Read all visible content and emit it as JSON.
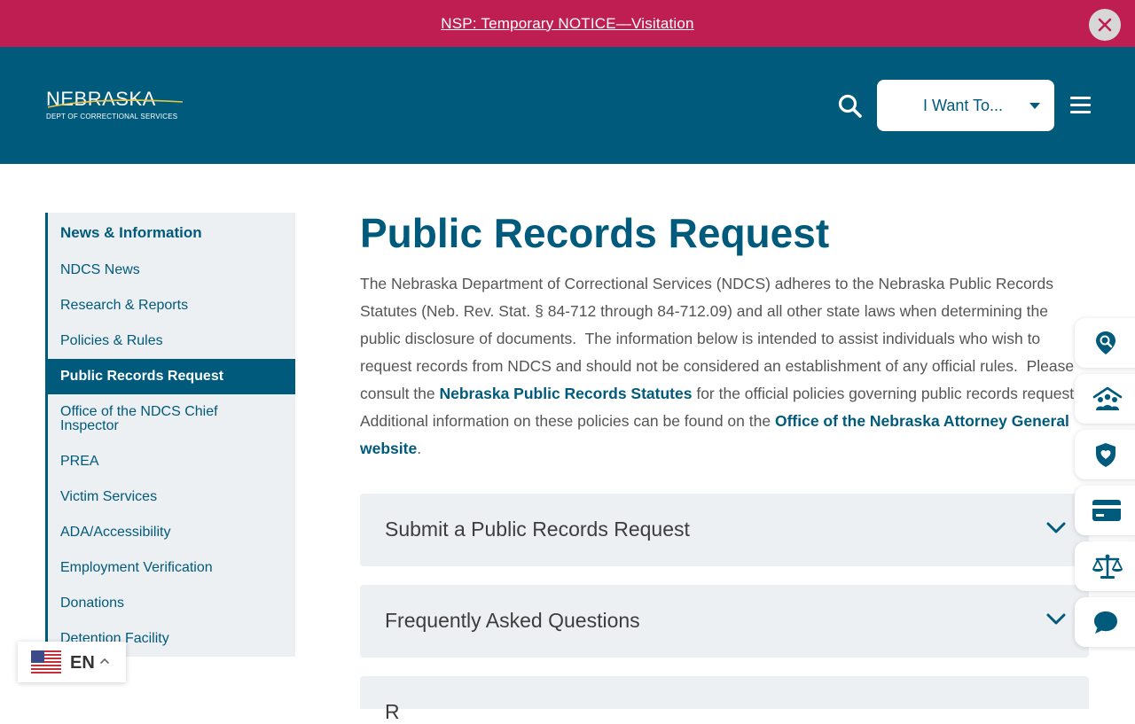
{
  "notice": {
    "text": "NSP: Temporary NOTICE—Visitation",
    "close_icon": "close-icon"
  },
  "header": {
    "logo_text": "NEBRASKA",
    "logo_subtext": "DEPT OF CORRECTIONAL SERVICES",
    "search_icon": "search-icon",
    "want_to_label": "I Want To...",
    "menu_icon": "hamburger-icon"
  },
  "sidebar": {
    "heading": "News & Information",
    "items": [
      {
        "label": "NDCS News",
        "active": false
      },
      {
        "label": "Research & Reports",
        "active": false
      },
      {
        "label": "Policies & Rules",
        "active": false
      },
      {
        "label": "Public Records Request",
        "active": true
      },
      {
        "label": "Office of the NDCS Chief Inspector",
        "active": false
      },
      {
        "label": "PREA",
        "active": false
      },
      {
        "label": "Victim Services",
        "active": false
      },
      {
        "label": "ADA/Accessibility",
        "active": false
      },
      {
        "label": "Employment Verification",
        "active": false
      },
      {
        "label": "Donations",
        "active": false
      },
      {
        "label": "Detention Facility",
        "active": false
      }
    ]
  },
  "main": {
    "title": "Public Records Request",
    "intro_part1": "The Nebraska Department of Correctional Services (NDCS) adheres to the Nebraska Public Records Statutes (Neb. Rev. Stat. § 84-712 through 84-712.09) and all other state laws when determining the public disclosure of documents.  The information below is intended to assist individuals who wish to request records from NDCS and should not be considered an establishment of any official rules.  Please consult the ",
    "intro_link1": "Nebraska Public Records Statutes",
    "intro_part2": " for the official policies governing public records request.  Additional information on these policies can be found on the ",
    "intro_link2": "Office of the Nebraska Attorney General website",
    "intro_part3": ".",
    "accordions": [
      {
        "title": "Submit a Public Records Request"
      },
      {
        "title": "Frequently Asked Questions"
      },
      {
        "title": "R"
      }
    ]
  },
  "floating_buttons": [
    {
      "icon": "location-search-icon"
    },
    {
      "icon": "family-icon"
    },
    {
      "icon": "shield-heart-icon"
    },
    {
      "icon": "payment-card-icon"
    },
    {
      "icon": "scales-justice-icon"
    },
    {
      "icon": "chat-bubble-icon"
    }
  ],
  "language": {
    "code": "EN",
    "flag_icon": "us-flag-icon"
  },
  "colors": {
    "notice_bg": "#be1e52",
    "header_bg": "#005a7b",
    "accent": "#005a7b",
    "panel_bg": "#edf0f3"
  }
}
